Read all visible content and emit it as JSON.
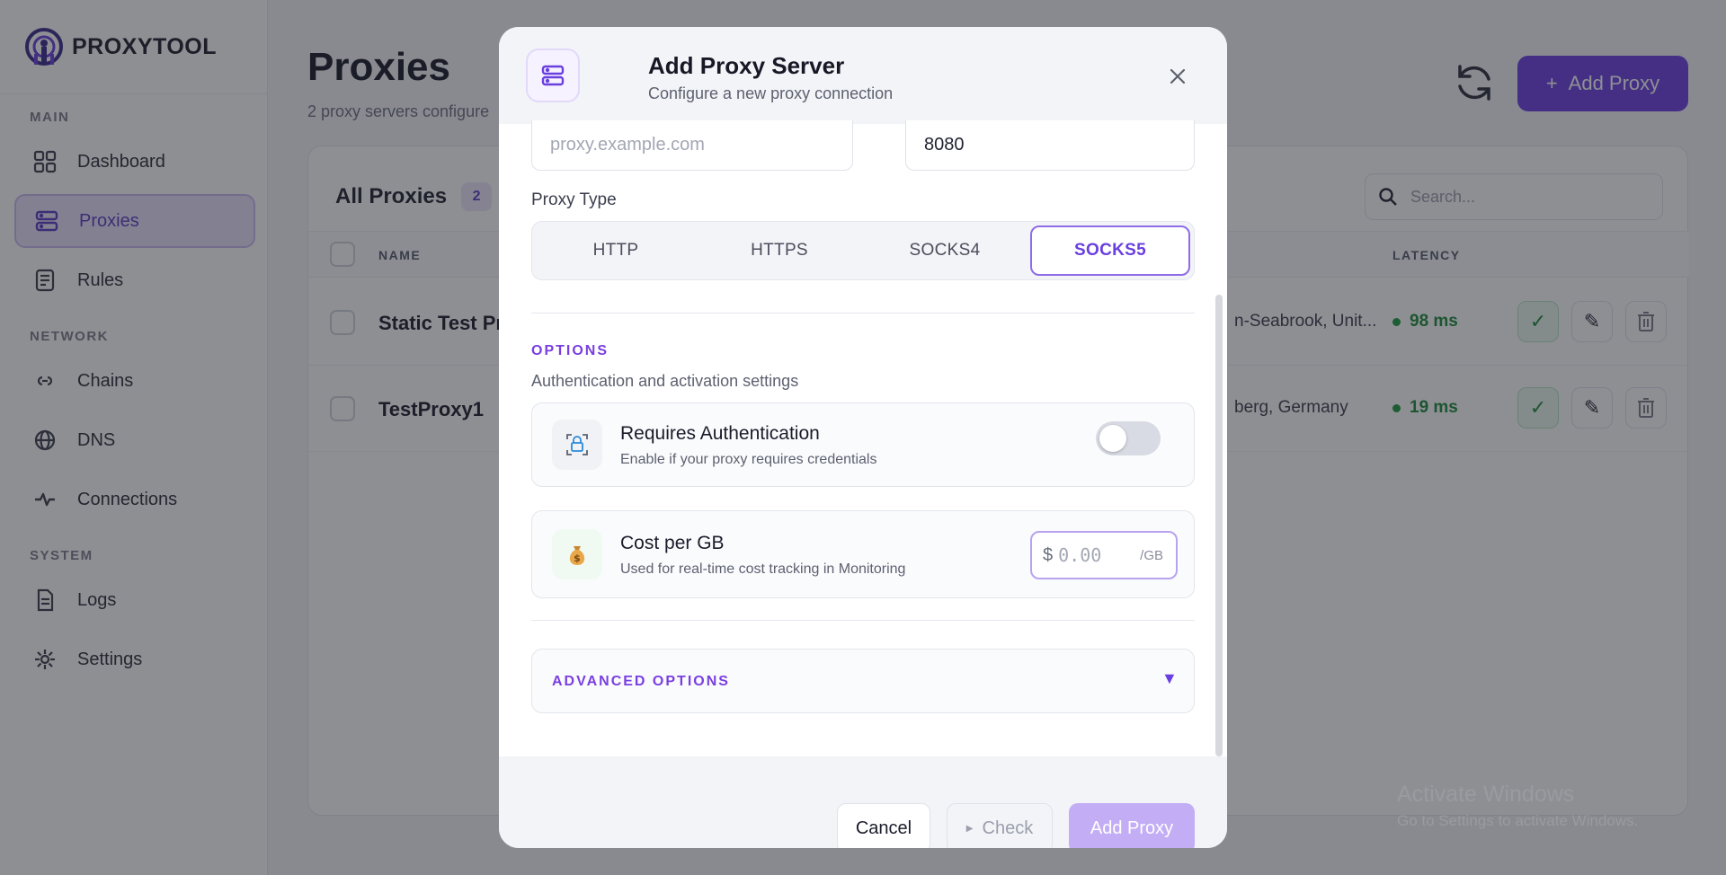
{
  "brand": {
    "name": "PROXYTOOL"
  },
  "sidebar": {
    "sections": {
      "main": "MAIN",
      "network": "NETWORK",
      "system": "SYSTEM"
    },
    "items": [
      {
        "label": "Dashboard",
        "icon": "grid-icon",
        "active": false
      },
      {
        "label": "Proxies",
        "icon": "server-icon",
        "active": true
      },
      {
        "label": "Rules",
        "icon": "rules-icon",
        "active": false
      },
      {
        "label": "Chains",
        "icon": "chain-icon",
        "active": false
      },
      {
        "label": "DNS",
        "icon": "globe-icon",
        "active": false
      },
      {
        "label": "Connections",
        "icon": "pulse-icon",
        "active": false
      },
      {
        "label": "Logs",
        "icon": "document-icon",
        "active": false
      },
      {
        "label": "Settings",
        "icon": "gear-icon",
        "active": false
      }
    ]
  },
  "page": {
    "title": "Proxies",
    "subtitle": "2 proxy servers configure",
    "add_button": "Add Proxy"
  },
  "table": {
    "title": "All Proxies",
    "count": "2",
    "search_placeholder": "Search...",
    "columns": {
      "name": "NAME",
      "latency": "LATENCY"
    },
    "rows": [
      {
        "name": "Static Test Pro",
        "location": "n-Seabrook, Unit...",
        "latency": "98 ms"
      },
      {
        "name": "TestProxy1",
        "location": "berg, Germany",
        "latency": "19 ms"
      }
    ]
  },
  "modal": {
    "title": "Add Proxy Server",
    "subtitle": "Configure a new proxy connection",
    "host_placeholder": "proxy.example.com",
    "port_value": "8080",
    "proxy_type_label": "Proxy Type",
    "proxy_types": [
      "HTTP",
      "HTTPS",
      "SOCKS4",
      "SOCKS5"
    ],
    "selected_type": "SOCKS5",
    "options_title": "OPTIONS",
    "options_subtitle": "Authentication and activation settings",
    "auth": {
      "name": "Requires Authentication",
      "desc": "Enable if your proxy requires credentials",
      "enabled": false
    },
    "cost": {
      "name": "Cost per GB",
      "desc": "Used for real-time cost tracking in Monitoring",
      "currency": "$",
      "placeholder": "0.00",
      "unit": "/GB"
    },
    "advanced_label": "ADVANCED OPTIONS",
    "footer": {
      "cancel": "Cancel",
      "check": "Check",
      "add": "Add Proxy"
    }
  },
  "watermark": {
    "line1": "Activate Windows",
    "line2": "Go to Settings to activate Windows."
  },
  "colors": {
    "accent": "#6a3fe0",
    "success": "#1c8a3a"
  }
}
